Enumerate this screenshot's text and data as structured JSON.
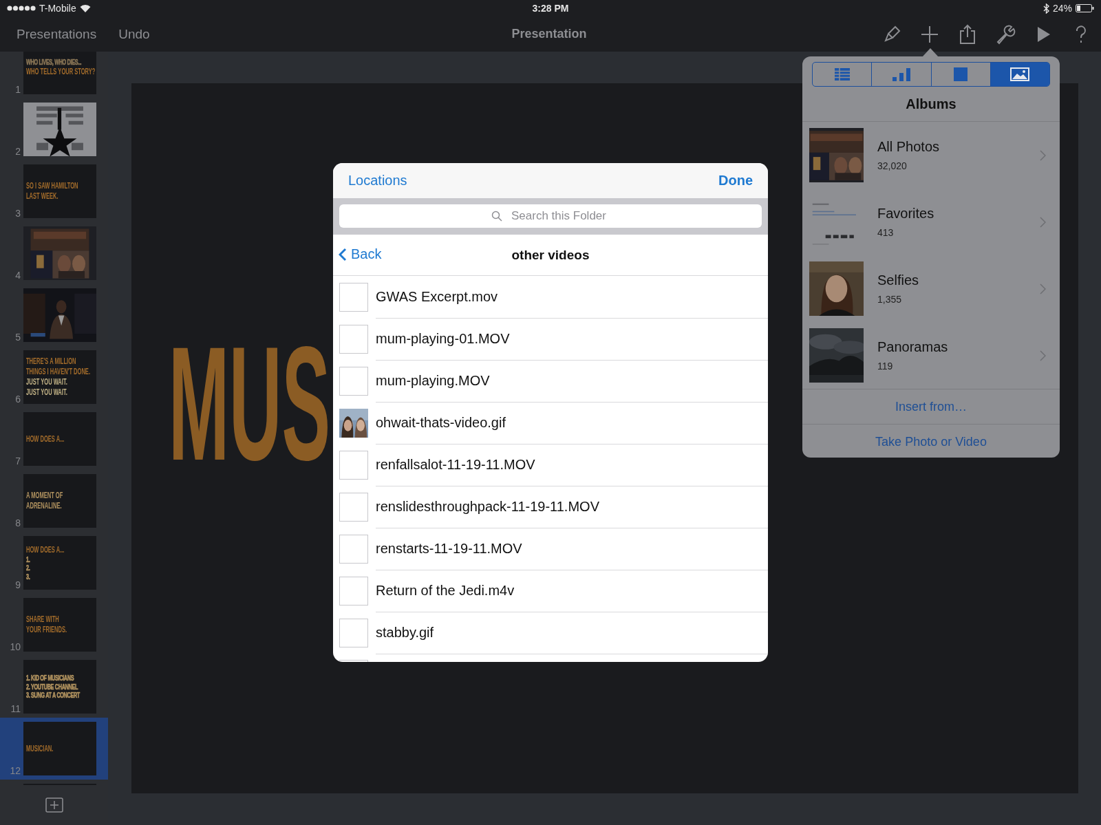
{
  "status_bar": {
    "carrier": "T-Mobile",
    "time": "3:28 PM",
    "battery": "24%"
  },
  "toolbar": {
    "left_buttons": [
      "Presentations",
      "Undo"
    ],
    "title": "Presentation"
  },
  "slides": [
    {
      "number": "1",
      "selected": false,
      "kind": "text",
      "lines": [
        {
          "text": "WHO LIVES, WHO DIES...",
          "kind": "small",
          "color": "#8a7656"
        },
        {
          "text": "WHO TELLS YOUR STORY?",
          "kind": "title",
          "color": "#a36c2b"
        }
      ]
    },
    {
      "number": "2",
      "selected": false,
      "kind": "picture"
    },
    {
      "number": "3",
      "selected": false,
      "kind": "text",
      "lines": [
        {
          "text": "SO I SAW HAMILTON",
          "kind": "title",
          "color": "#a36c2b"
        },
        {
          "text": "LAST WEEK.",
          "kind": "title",
          "color": "#a36c2b"
        }
      ]
    },
    {
      "number": "4",
      "selected": false,
      "kind": "picture"
    },
    {
      "number": "5",
      "selected": false,
      "kind": "picture"
    },
    {
      "number": "6",
      "selected": false,
      "kind": "text",
      "lines": [
        {
          "text": "THERE'S A MILLION",
          "kind": "title",
          "color": "#a36c2b"
        },
        {
          "text": "THINGS I HAVEN'T DONE.",
          "kind": "title",
          "color": "#a36c2b"
        },
        {
          "text": "JUST YOU WAIT.",
          "kind": "title",
          "color": "#c4b487"
        },
        {
          "text": "JUST YOU WAIT.",
          "kind": "title",
          "color": "#c4b487"
        }
      ]
    },
    {
      "number": "7",
      "selected": false,
      "kind": "text",
      "lines": [
        {
          "text": "HOW DOES A...",
          "kind": "title",
          "color": "#a36c2b"
        }
      ]
    },
    {
      "number": "8",
      "selected": false,
      "kind": "text",
      "lines": [
        {
          "text": "A MOMENT OF",
          "kind": "title",
          "color": "#b39460"
        },
        {
          "text": "ADRENALINE.",
          "kind": "title",
          "color": "#b39460"
        }
      ]
    },
    {
      "number": "9",
      "selected": false,
      "kind": "text",
      "lines": [
        {
          "text": "HOW DOES A...",
          "kind": "title",
          "color": "#a36c2b"
        },
        {
          "text": "1.",
          "kind": "small",
          "color": "#b39460"
        },
        {
          "text": "2.",
          "kind": "small",
          "color": "#b39460"
        },
        {
          "text": "3.",
          "kind": "small",
          "color": "#b39460"
        }
      ]
    },
    {
      "number": "10",
      "selected": false,
      "kind": "text",
      "lines": [
        {
          "text": "SHARE WITH",
          "kind": "title",
          "color": "#a36c2b"
        },
        {
          "text": "YOUR FRIENDS.",
          "kind": "title",
          "color": "#a36c2b"
        }
      ]
    },
    {
      "number": "11",
      "selected": false,
      "kind": "text",
      "lines": [
        {
          "text": "1. KID OF MUSICIANS",
          "kind": "small",
          "color": "#b39460"
        },
        {
          "text": "2. YOUTUBE CHANNEL",
          "kind": "small",
          "color": "#b39460"
        },
        {
          "text": "3. SUNG AT A CONCERT",
          "kind": "small",
          "color": "#b39460"
        }
      ]
    },
    {
      "number": "12",
      "selected": true,
      "kind": "text",
      "lines": [
        {
          "text": "MUSICIAN.",
          "kind": "title",
          "color": "#a36c2b"
        }
      ]
    },
    {
      "selected": false,
      "kind": "text"
    }
  ],
  "slide": {
    "title": "MUS"
  },
  "file_browser": {
    "locations": "Locations",
    "done": "Done",
    "search": {
      "placeholder": "Search this Folder"
    },
    "back": "Back",
    "folder": "other videos",
    "files": [
      {
        "name": "GWAS Excerpt.mov",
        "kind": "blank"
      },
      {
        "name": "mum-playing-01.MOV",
        "kind": "blank"
      },
      {
        "name": "mum-playing.MOV",
        "kind": "blank"
      },
      {
        "name": "ohwait-thats-video.gif",
        "kind": "picture"
      },
      {
        "name": "renfallsalot-11-19-11.MOV",
        "kind": "blank"
      },
      {
        "name": "renslidesthroughpack-11-19-11.MOV",
        "kind": "blank"
      },
      {
        "name": "renstarts-11-19-11.MOV",
        "kind": "blank"
      },
      {
        "name": "Return of the Jedi.m4v",
        "kind": "blank"
      },
      {
        "name": "stabby.gif",
        "kind": "blank"
      }
    ]
  },
  "media_popover": {
    "tabs": [
      {
        "kind": "table",
        "selected": false
      },
      {
        "kind": "chart",
        "selected": false
      },
      {
        "kind": "shape",
        "selected": false
      },
      {
        "kind": "media",
        "selected": true
      }
    ],
    "title": "Albums",
    "albums": [
      {
        "name": "All Photos",
        "count": "32,020"
      },
      {
        "name": "Favorites",
        "count": "413"
      },
      {
        "name": "Selfies",
        "count": "1,355"
      },
      {
        "name": "Panoramas",
        "count": "119"
      }
    ],
    "actions": [
      "Insert from…",
      "Take Photo or Video"
    ]
  }
}
